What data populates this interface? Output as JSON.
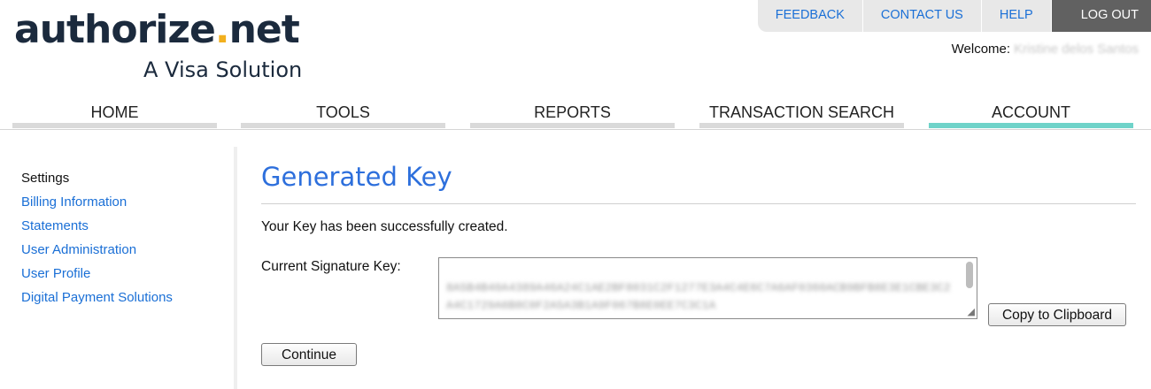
{
  "brand": {
    "name": "authorize",
    "dot": ".",
    "tld": "net",
    "tagline": "A Visa Solution"
  },
  "toplinks": [
    {
      "label": "FEEDBACK"
    },
    {
      "label": "CONTACT US"
    },
    {
      "label": "HELP"
    },
    {
      "label": "LOG OUT"
    }
  ],
  "welcome": {
    "label": "Welcome:",
    "name": "Kristine delos Santos"
  },
  "nav": [
    {
      "label": "HOME"
    },
    {
      "label": "TOOLS"
    },
    {
      "label": "REPORTS"
    },
    {
      "label": "TRANSACTION SEARCH"
    },
    {
      "label": "ACCOUNT",
      "active": true
    }
  ],
  "sidebar": {
    "heading": "Settings",
    "items": [
      {
        "label": "Billing Information"
      },
      {
        "label": "Statements"
      },
      {
        "label": "User Administration"
      },
      {
        "label": "User Profile"
      },
      {
        "label": "Digital Payment Solutions"
      }
    ]
  },
  "main": {
    "title": "Generated Key",
    "success_message": "Your Key has been successfully created.",
    "key_label": "Current Signature Key:",
    "key_value": "8A5B4B40A4389A46A24C1AE2BF8031C2F1277E3A4C4E6C7A6AF0360ACB9BFB8E3E1CBE3C2A4C1729A6B8C0F2A5A3B1A9F067B8E0EE7C3C1A",
    "copy_button": "Copy to Clipboard",
    "continue_button": "Continue"
  },
  "colors": {
    "accent": "#2d6fdc",
    "link": "#1a6fd6",
    "active_tab": "#6fd3c9",
    "logout_bg": "#616161",
    "logo_dot": "#f2b01e"
  }
}
